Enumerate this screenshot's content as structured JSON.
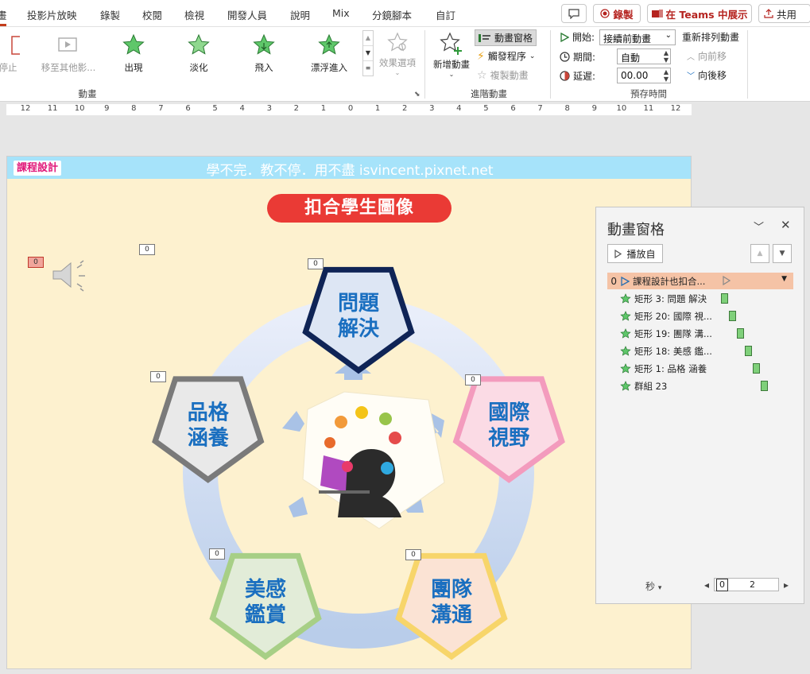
{
  "tabs": [
    {
      "label": "畫"
    },
    {
      "label": "投影片放映"
    },
    {
      "label": "錄製"
    },
    {
      "label": "校閱"
    },
    {
      "label": "檢視"
    },
    {
      "label": "開發人員"
    },
    {
      "label": "說明"
    },
    {
      "label": "Mix"
    },
    {
      "label": "分鏡腳本"
    },
    {
      "label": "自訂"
    }
  ],
  "topbar": {
    "record_label": "錄製",
    "teams_label": "在 Teams 中展示",
    "share_label": "共用"
  },
  "ribbon": {
    "animations": [
      {
        "label": "停止",
        "dim": true
      },
      {
        "label": "移至其他影...",
        "dim": true
      },
      {
        "label": "出現",
        "dim": false
      },
      {
        "label": "淡化",
        "dim": false
      },
      {
        "label": "飛入",
        "dim": false
      },
      {
        "label": "漂浮進入",
        "dim": false
      }
    ],
    "effect_options_label": "效果選項",
    "animation_group_label": "動畫",
    "add_animation_label": "新增動畫",
    "animation_pane_label": "動畫窗格",
    "trigger_label": "觸發程序",
    "painter_label": "複製動畫",
    "advanced_group_label": "進階動畫",
    "start_label": "開始:",
    "start_value": "接續前動畫",
    "duration_label": "期間:",
    "duration_value": "自動",
    "delay_label": "延遲:",
    "delay_value": "00.00",
    "reorder_label": "重新排列動畫",
    "move_earlier_label": "向前移",
    "move_later_label": "向後移",
    "timing_group_label": "預存時間"
  },
  "ruler": [
    "12",
    "11",
    "10",
    "9",
    "8",
    "7",
    "6",
    "5",
    "4",
    "3",
    "2",
    "1",
    "0",
    "1",
    "2",
    "3",
    "4",
    "5",
    "6",
    "7",
    "8",
    "9",
    "10",
    "11",
    "12"
  ],
  "slide": {
    "course_tag": "課程設計",
    "banner": "學不完．教不停．用不盡 isvincent.pixnet.net",
    "title": "扣合學生圖像",
    "pentagons": [
      {
        "line1": "問題",
        "line2": "解決",
        "fill": "#dde6f4",
        "stroke": "#0f2456"
      },
      {
        "line1": "國際",
        "line2": "視野",
        "fill": "#fbdbe5",
        "stroke": "#f39bbd"
      },
      {
        "line1": "團隊",
        "line2": "溝通",
        "fill": "#fbe3d4",
        "stroke": "#f7d56a"
      },
      {
        "line1": "美感",
        "line2": "鑑賞",
        "fill": "#e2ecd8",
        "stroke": "#a7cf86"
      },
      {
        "line1": "品格",
        "line2": "涵養",
        "fill": "#e9e9e9",
        "stroke": "#7a7a7a"
      }
    ],
    "text_color": "#1a6fc0",
    "badges": [
      "0",
      "0",
      "0",
      "0",
      "0",
      "0",
      "0",
      "0"
    ]
  },
  "pane": {
    "title": "動畫窗格",
    "play_label": "播放自",
    "rows": [
      {
        "num": "0",
        "label": "課程設計也扣合...",
        "selected": true
      },
      {
        "num": "",
        "label": "矩形 3: 問題 解決",
        "selected": false
      },
      {
        "num": "",
        "label": "矩形 20: 國際 視...",
        "selected": false
      },
      {
        "num": "",
        "label": "矩形 19: 團隊 溝...",
        "selected": false
      },
      {
        "num": "",
        "label": "矩形 18: 美感 鑑...",
        "selected": false
      },
      {
        "num": "",
        "label": "矩形 1: 品格 涵養",
        "selected": false
      },
      {
        "num": "",
        "label": "群組 23",
        "selected": false
      }
    ],
    "seconds_label": "秒",
    "timeline_start": "0",
    "timeline_mark": "2"
  }
}
